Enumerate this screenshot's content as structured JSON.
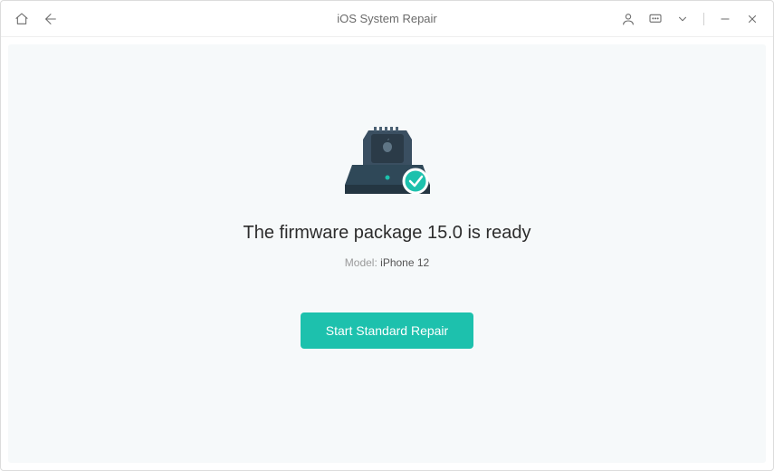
{
  "titlebar": {
    "title": "iOS System Repair"
  },
  "main": {
    "headline_prefix": "The firmware package",
    "firmware_version": "15.0",
    "headline_suffix": "is ready",
    "model_label": "Model:",
    "model_value": "iPhone 12",
    "cta_label": "Start Standard Repair"
  },
  "colors": {
    "accent": "#1dc1ad"
  }
}
